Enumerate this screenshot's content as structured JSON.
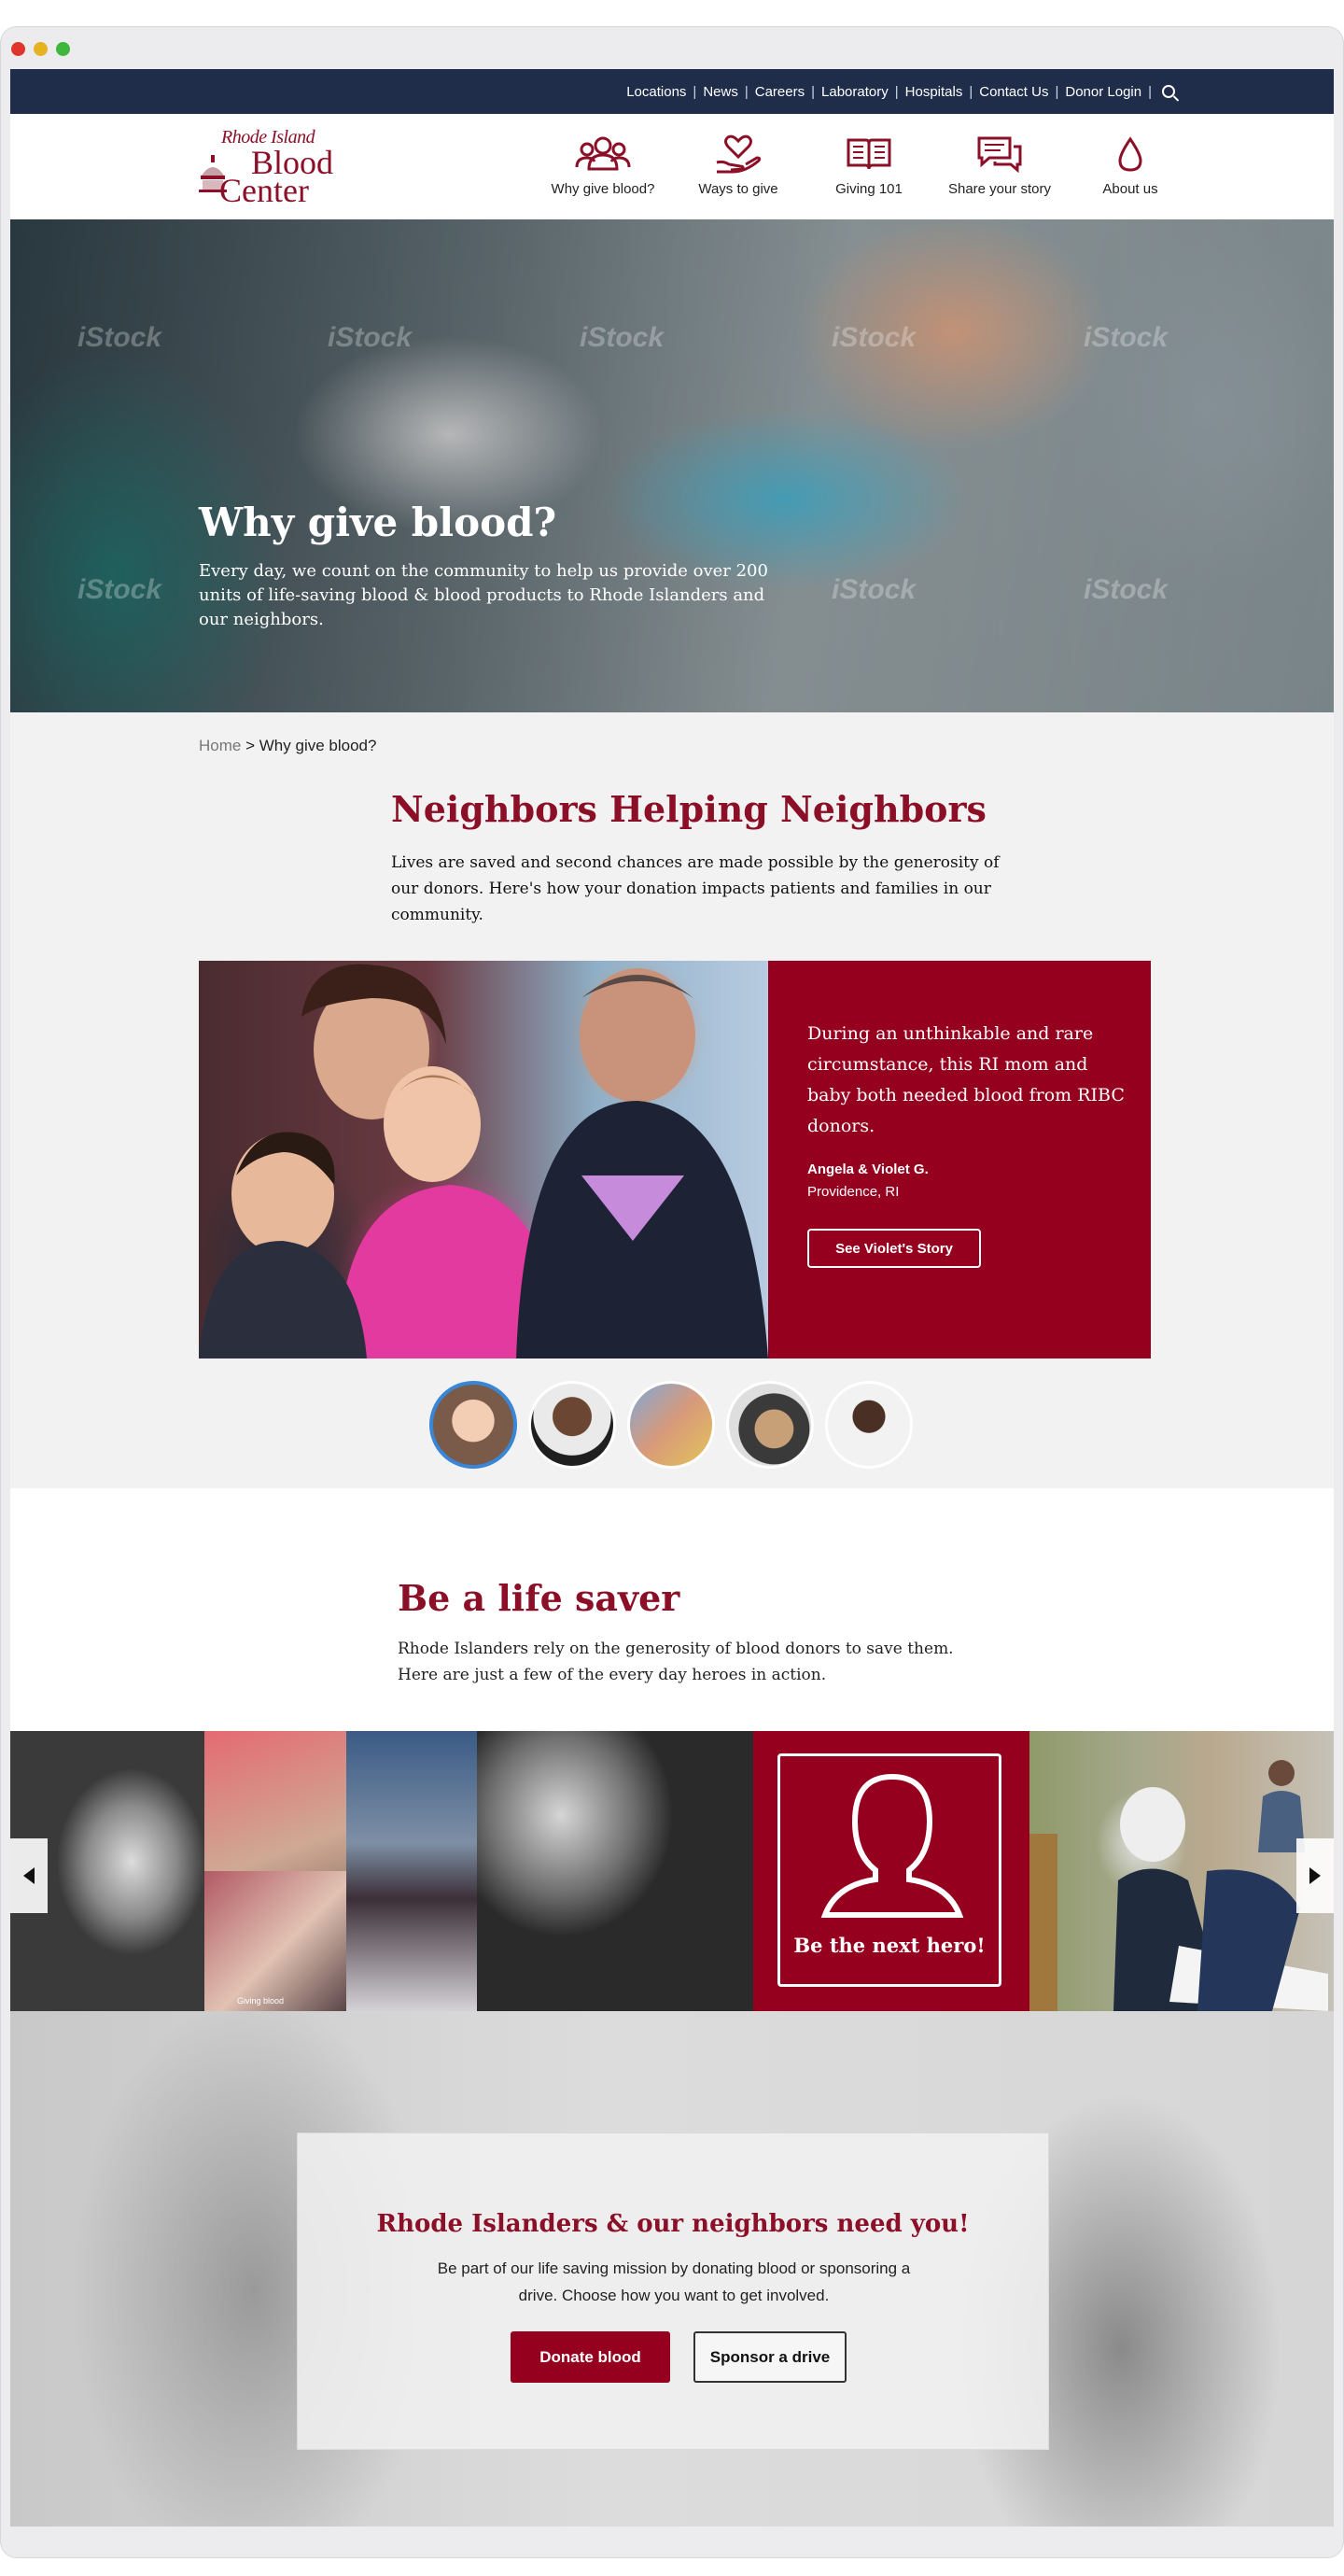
{
  "utility_nav": {
    "links": [
      "Locations",
      "News",
      "Careers",
      "Laboratory",
      "Hospitals",
      "Contact Us",
      "Donor Login"
    ],
    "search_icon": "search-icon"
  },
  "logo": {
    "line1": "Rhode Island",
    "line2": "Blood",
    "line3": "Center"
  },
  "main_nav": [
    {
      "label": "Why give blood?",
      "icon": "people-icon"
    },
    {
      "label": "Ways to give",
      "icon": "heart-hand-icon"
    },
    {
      "label": "Giving 101",
      "icon": "book-icon"
    },
    {
      "label": "Share your story",
      "icon": "chat-icon"
    },
    {
      "label": "About us",
      "icon": "drop-icon"
    }
  ],
  "hero": {
    "title": "Why give blood?",
    "text": "Every day, we count on the community to help us provide over 200 units of life-saving blood & blood products to Rhode Islanders and our neighbors.",
    "watermark": "iStock"
  },
  "breadcrumb": {
    "home": "Home",
    "separator": ">",
    "current": "Why give blood?"
  },
  "neighbors": {
    "title": "Neighbors Helping Neighbors",
    "text": "Lives are saved and second chances are made possible by the generosity of our donors. Here's how your donation impacts patients and families in our community.",
    "story": {
      "quote": "During an unthinkable and rare circumstance, this RI mom and baby both needed blood from RIBC donors.",
      "name": "Angela & Violet G.",
      "place": "Providence, RI",
      "button": "See Violet's Story"
    }
  },
  "life_saver": {
    "title": "Be a life saver",
    "text": "Rhode Islanders rely on the generosity of blood donors to save them. Here are just a few of the every day heroes in action.",
    "hero_tile": "Be the next hero!",
    "caption": "Giving blood"
  },
  "cta": {
    "title": "Rhode Islanders & our neighbors need you!",
    "text": "Be part of our life saving mission by donating blood or sponsoring a drive. Choose how you want to get involved.",
    "donate": "Donate blood",
    "sponsor": "Sponsor a drive"
  },
  "colors": {
    "brand_red": "#95001f",
    "navy": "#1f2d4a",
    "thumb_active": "#3a86d6"
  }
}
